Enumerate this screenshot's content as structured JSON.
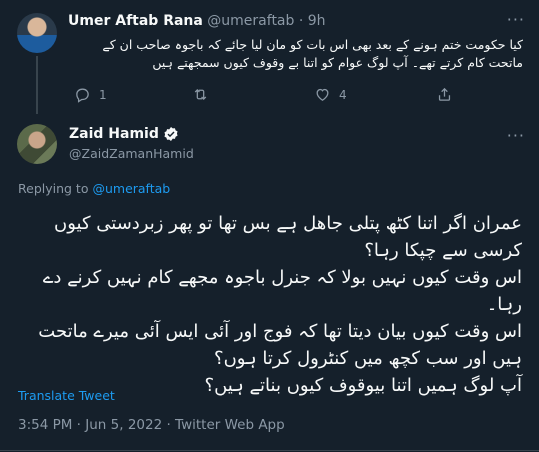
{
  "parent_tweet": {
    "author_name": "Umer Aftab Rana",
    "handle": "@umeraftab",
    "separator": "·",
    "time": "9h",
    "more": "···",
    "text": "کیا حکومت ختم ہونے کے بعد بھی اس بات کو مان لیا جائے کہ باجوہ صاحب ان کے ماتحت کام کرتے تھے۔ آپ لوگ عوام کو اتنا بے وقوف کیوں سمجھتے ہیں",
    "reply_count": "1",
    "retweet_count": "",
    "like_count": "4",
    "icons": [
      "reply-icon",
      "retweet-icon",
      "like-icon",
      "share-icon"
    ]
  },
  "main_tweet": {
    "author_name": "Zaid Hamid",
    "verified": true,
    "handle": "@ZaidZamanHamid",
    "more": "···",
    "replying_prefix": "Replying to",
    "replying_to": "@umeraftab",
    "lines": [
      "عمران اگر اتنا کٹھ پتلی جاھل ہے بس  تھا تو پھر زبردستی کیوں کرسی سے چپکا رہا؟",
      "اس وقت کیوں نہیں بولا کہ جنرل باجوہ مجھے کام نہیں کرنے دے رہا۔",
      "اس وقت کیوں بیان دیتا تھا کہ فوج اور آئی ایس آئی میرے ماتحت ہیں اور سب کچھ میں کنٹرول کرتا ہوں؟",
      "آپ لوگ ہمیں اتنا بیوقوف کیوں  بناتے  ہیں؟"
    ],
    "translate_label": "Translate Tweet",
    "timestamp": "3:54 PM · Jun 5, 2022 · Twitter Web App"
  },
  "colors": {
    "background": "#15202b",
    "text": "#f7f9f9",
    "muted": "#8b98a5",
    "accent": "#1d9bf0",
    "divider": "#38444d"
  }
}
